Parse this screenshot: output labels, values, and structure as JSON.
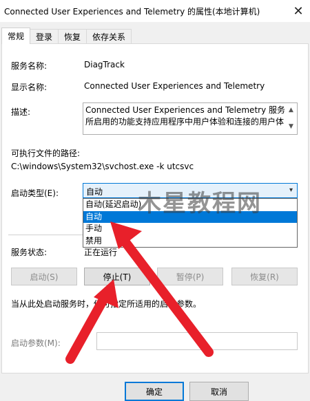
{
  "window": {
    "title": "Connected User Experiences and Telemetry 的属性(本地计算机)",
    "close_symbol": "✕"
  },
  "tabs": [
    {
      "label": "常规",
      "active": true
    },
    {
      "label": "登录",
      "active": false
    },
    {
      "label": "恢复",
      "active": false
    },
    {
      "label": "依存关系",
      "active": false
    }
  ],
  "general": {
    "service_name_label": "服务名称:",
    "service_name_value": "DiagTrack",
    "display_name_label": "显示名称:",
    "display_name_value": "Connected User Experiences and Telemetry",
    "description_label": "描述:",
    "description_lines": [
      "Connected User Experiences and Telemetry 服务",
      "所启用的功能支持应用程序中用户体验和连接的用户体"
    ],
    "exe_path_label": "可执行文件的路径:",
    "exe_path_value": "C:\\windows\\System32\\svchost.exe -k utcsvc",
    "startup_type_label": "启动类型(E):",
    "startup_type_selected": "自动",
    "startup_options": [
      "自动(延迟启动)",
      "自动",
      "手动",
      "禁用"
    ],
    "startup_highlighted_index": 1,
    "service_status_label": "服务状态:",
    "service_status_value": "正在运行",
    "buttons": {
      "start": "启动(S)",
      "stop": "停止(T)",
      "pause": "暂停(P)",
      "resume": "恢复(R)"
    },
    "hint_text": "当从此处启动服务时，你可指定所适用的启动参数。",
    "start_params_label": "启动参数(M):"
  },
  "dialog_buttons": {
    "ok": "确定",
    "cancel": "取消"
  },
  "watermark": "木星教程网",
  "colors": {
    "accent": "#0078d7",
    "annotation_arrow": "#e8202a"
  }
}
